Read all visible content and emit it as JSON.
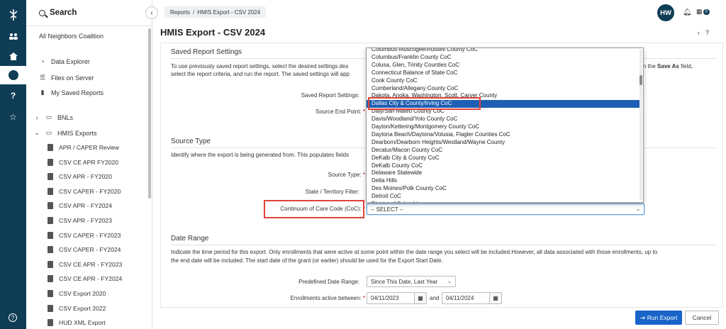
{
  "sidebar": {
    "search_label": "Search",
    "org": "All Neighbors Coalition",
    "top_items": [
      {
        "label": "Data Explorer"
      },
      {
        "label": "Files on Server"
      },
      {
        "label": "My Saved Reports"
      }
    ],
    "folders": [
      {
        "label": "BNLs"
      },
      {
        "label": "HMIS Exports"
      }
    ],
    "reports": [
      "APR / CAPER Review",
      "CSV CE APR FY2020",
      "CSV APR - FY2020",
      "CSV CAPER - FY2020",
      "CSV APR - FY2024",
      "CSV APR - FY2023",
      "CSV CAPER - FY2023",
      "CSV CAPER - FY2024",
      "CSV CE APR - FY2023",
      "CSV CE APR - FY2024",
      "CSV Export 2020",
      "CSV Export 2022",
      "HUD XML Export"
    ]
  },
  "header": {
    "breadcrumb_root": "Reports",
    "breadcrumb_sep": "/",
    "breadcrumb_current": "HMIS Export - CSV 2024",
    "avatar": "HW",
    "badge": "0"
  },
  "page": {
    "title": "HMIS Export - CSV 2024"
  },
  "saved": {
    "heading": "Saved Report Settings",
    "desc_line1_left": "To use previously saved report settings, select the desired settings des",
    "desc_line1_right_pre": "n the",
    "desc_line1_bold": "Save As",
    "desc_line1_right_post": "field,",
    "desc_line2": "select the report criteria, and run the report. The saved settings will app",
    "saved_label": "Saved Report Settings:",
    "end_label": "Source End Point:"
  },
  "source": {
    "heading": "Source Type",
    "desc": "Identify where the export is being generated from. This populates fields",
    "type_label": "Source Type:",
    "state_label": "State / Territory Filter:",
    "coc_label": "Continuum of Care Code (CoC):",
    "coc_value": "-- SELECT --"
  },
  "dropdown": {
    "options": [
      "Columbus-Muscogee/Russell County CoC",
      "Columbus/Franklin County CoC",
      "Colusa, Glen, Trinity Counties CoC",
      "Connecticut Balance of State CoC",
      "Cook County CoC",
      "Cumberland/Allegany County CoC",
      "Dakota, Anoka, Washington, Scott, Carver County",
      "Dallas City & County/Irving CoC",
      "Daly/San Mateo County CoC",
      "Davis/Woodland/Yolo County CoC",
      "Dayton/Kettering/Montgomery County CoC",
      "Daytona Beach/Daytona/Volusia, Flagler Counties CoC",
      "Dearborn/Dearborn Heights/Westland/Wayne County",
      "Decatur/Macon County CoC",
      "DeKalb City & County CoC",
      "DeKalb County CoC",
      "Delaware Statewide",
      "Delta Hills",
      "Des Moines/Polk County CoC",
      "Detroit CoC",
      "District of Columbia"
    ],
    "selected_index": 7
  },
  "date": {
    "heading": "Date Range",
    "desc1": "Indicate the time period for this export. Only enrollments that were active at some point within the date range you select will be included.However, all data associated with those enrollments, up to",
    "desc2": "the end date will be included. The start date of the grant (or earlier) should be used for the Export Start Date.",
    "predef_label": "Predefined Date Range:",
    "predef_value": "Since This Date, Last Year",
    "between_label": "Enrollments active between:",
    "start": "04/11/2023",
    "and": "and",
    "end": "04/11/2024"
  },
  "footer": {
    "run": "Run Export",
    "cancel": "Cancel"
  },
  "colors": {
    "rail": "#0f3d55",
    "accent": "#1864c9",
    "highlight": "#1e5fb4",
    "callout": "#e0433a"
  }
}
